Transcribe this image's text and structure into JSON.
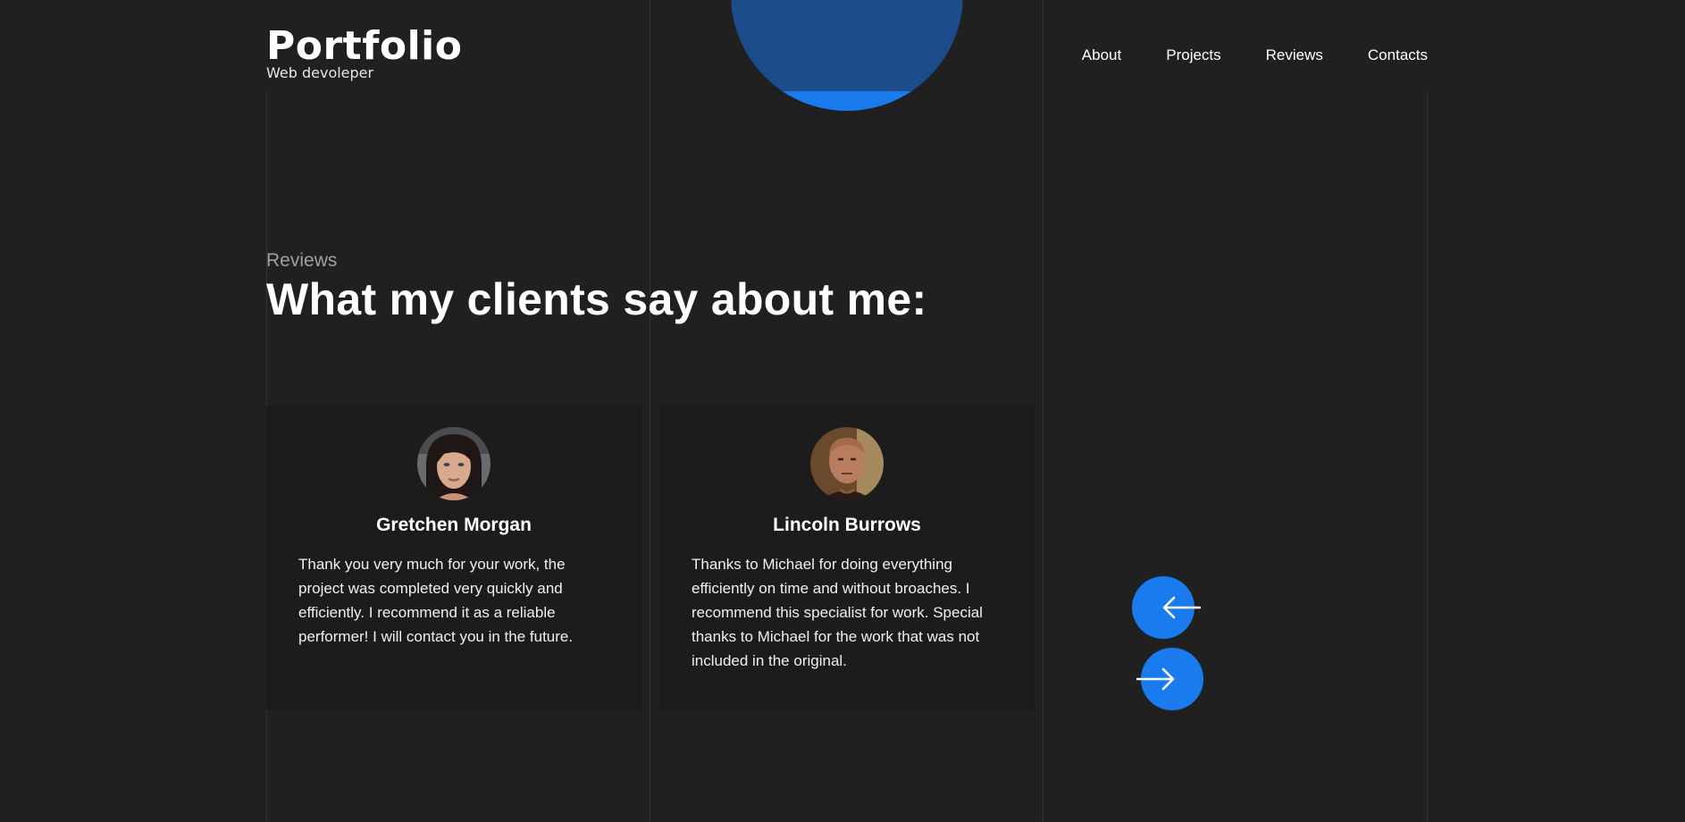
{
  "header": {
    "title": "Portfolio",
    "subtitle": "Web devoleper"
  },
  "nav": {
    "items": [
      {
        "label": "About"
      },
      {
        "label": "Projects"
      },
      {
        "label": "Reviews"
      },
      {
        "label": "Contacts"
      }
    ]
  },
  "reviews": {
    "kicker": "Reviews",
    "heading": "What my clients say about me:",
    "items": [
      {
        "name": "Gretchen Morgan",
        "text": "Thank you very much for your work, the project was completed very quickly and efficiently. I recommend it as a reliable performer! I will contact you in the future.",
        "avatar_icon": "woman-portrait-avatar"
      },
      {
        "name": "Lincoln Burrows",
        "text": "Thanks to Michael for doing everything efficiently on time and without broaches. I recommend this specialist for work. Special thanks to Michael for the work that was not included in the original.",
        "avatar_icon": "man-portrait-avatar"
      }
    ],
    "prev_icon": "arrow-left-icon",
    "next_icon": "arrow-right-icon"
  },
  "colors": {
    "background": "#202020",
    "card": "#1c1c1c",
    "accent": "#1a7bee",
    "hero_circle": "#1c4c8a",
    "muted_text": "#a0a0a0"
  }
}
